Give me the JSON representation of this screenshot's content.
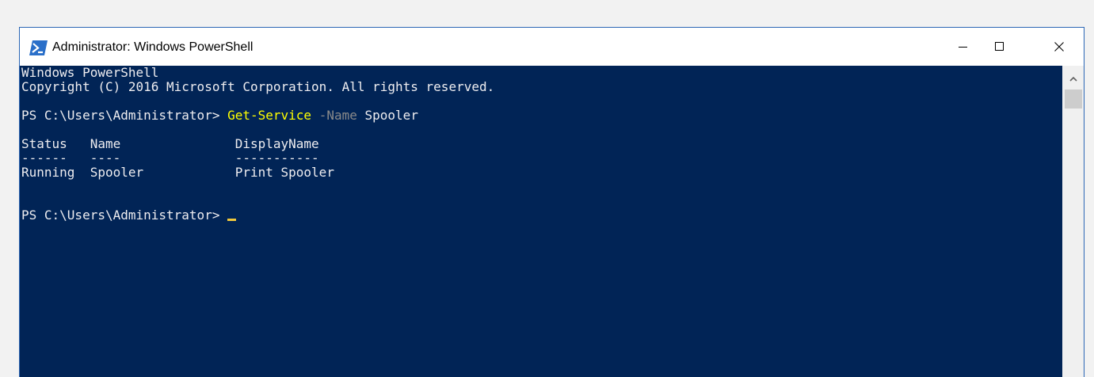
{
  "window": {
    "title": "Administrator: Windows PowerShell",
    "icon": "powershell-icon",
    "controls": {
      "minimize": "minimize-icon",
      "maximize": "maximize-icon",
      "close": "close-icon"
    }
  },
  "console": {
    "banner": [
      "Windows PowerShell",
      "Copyright (C) 2016 Microsoft Corporation. All rights reserved."
    ],
    "prompt": "PS C:\\Users\\Administrator> ",
    "command": {
      "cmdlet": "Get-Service",
      "parameter": "-Name",
      "argument": "Spooler"
    },
    "table": {
      "header": "Status   Name               DisplayName",
      "underline": "------   ----               -----------",
      "rows": [
        "Running  Spooler            Print Spooler"
      ]
    },
    "current_prompt": "PS C:\\Users\\Administrator> "
  },
  "colors": {
    "console_background": "#012456",
    "console_text": "#eeedf0",
    "cmdlet": "#ffff00",
    "parameter": "#8a8a8a",
    "cursor": "#f0c83c"
  },
  "scrollbar": {
    "up_icon": "chevron-up-icon"
  }
}
